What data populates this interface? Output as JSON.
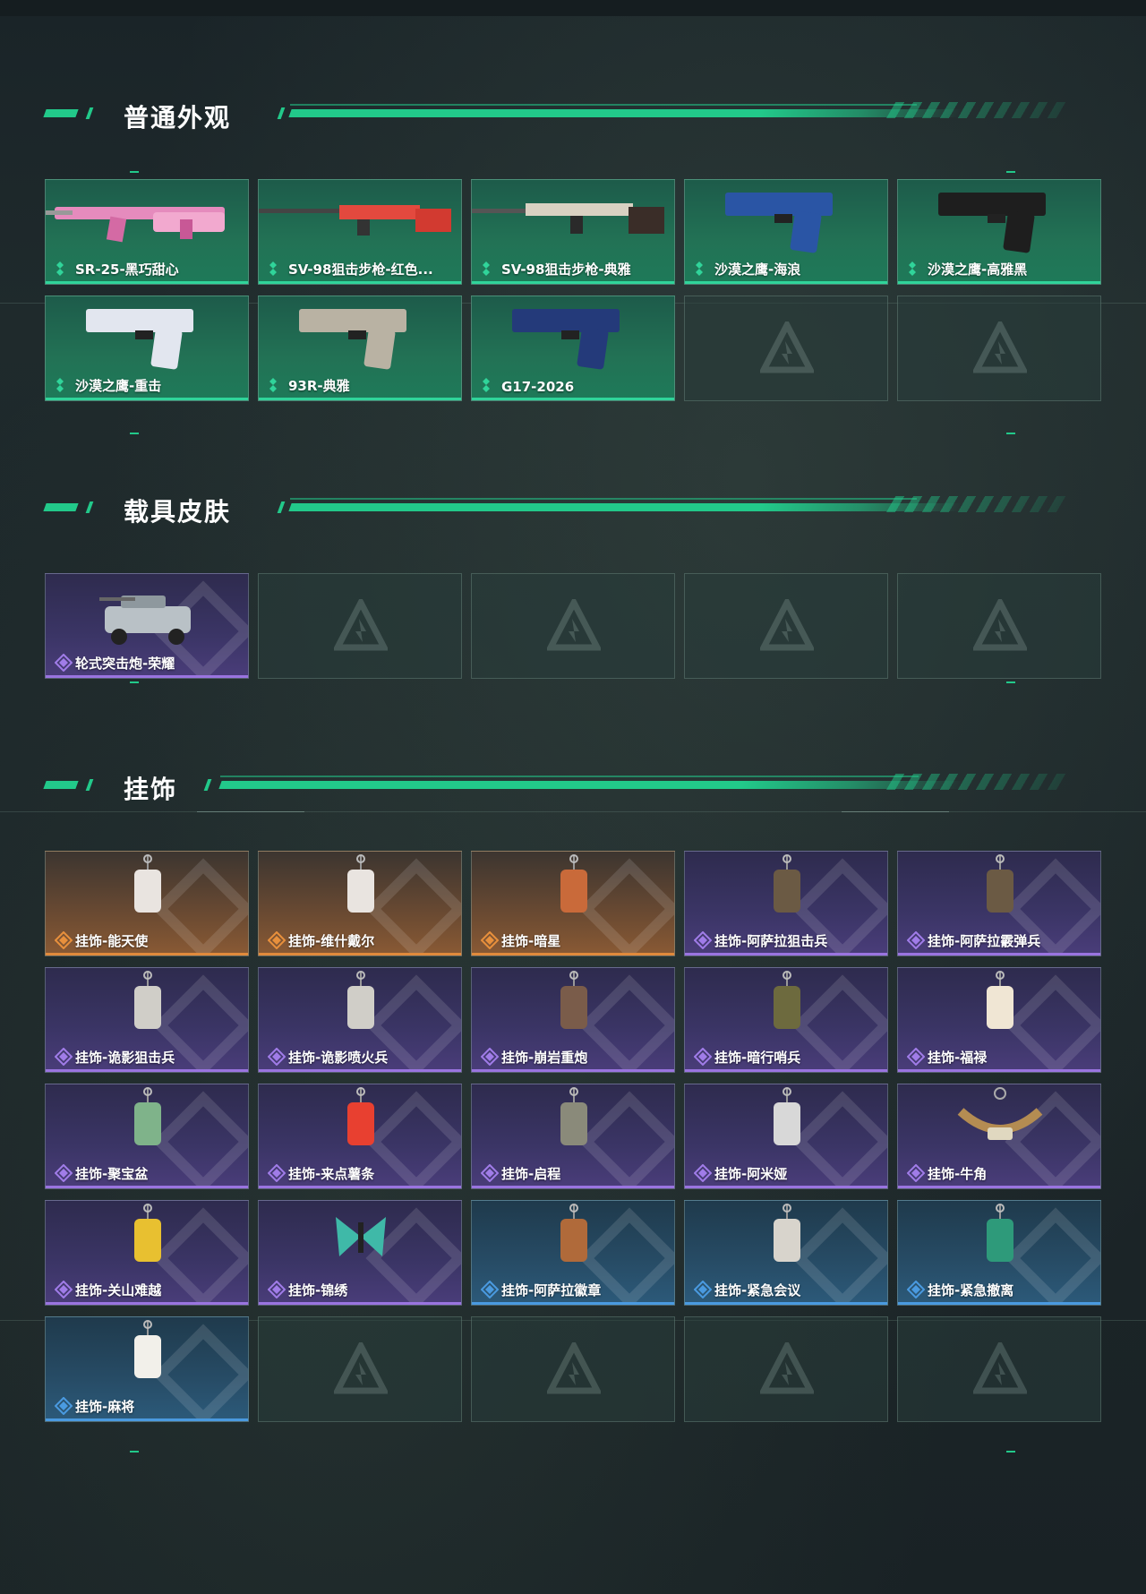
{
  "sections": {
    "weapon_skins": {
      "title": "普通外观",
      "items": [
        {
          "label": "SR-25-黑巧甜心",
          "rarity": "green",
          "icon": "rifle-pink-icon"
        },
        {
          "label": "SV-98狙击步枪-红色...",
          "rarity": "green",
          "icon": "sniper-red-icon"
        },
        {
          "label": "SV-98狙击步枪-典雅",
          "rarity": "green",
          "icon": "sniper-white-icon"
        },
        {
          "label": "沙漠之鹰-海浪",
          "rarity": "green",
          "icon": "pistol-blue-icon"
        },
        {
          "label": "沙漠之鹰-高雅黑",
          "rarity": "green",
          "icon": "pistol-black-icon"
        },
        {
          "label": "沙漠之鹰-重击",
          "rarity": "green",
          "icon": "pistol-white-blue-icon"
        },
        {
          "label": "93R-典雅",
          "rarity": "green",
          "icon": "pistol-tan-icon"
        },
        {
          "label": "G17-2026",
          "rarity": "green",
          "icon": "pistol-navy-icon"
        }
      ]
    },
    "vehicle_skins": {
      "title": "载具皮肤",
      "items": [
        {
          "label": "轮式突击炮-荣耀",
          "rarity": "purple",
          "icon": "armored-vehicle-icon"
        }
      ]
    },
    "charms": {
      "title": "挂饰",
      "items": [
        {
          "label": "挂饰-能天使",
          "rarity": "orange",
          "icon": "charm-tag-icon"
        },
        {
          "label": "挂饰-维什戴尔",
          "rarity": "orange",
          "icon": "charm-tag-icon"
        },
        {
          "label": "挂饰-暗星",
          "rarity": "orange",
          "icon": "charm-bird-icon"
        },
        {
          "label": "挂饰-阿萨拉狙击兵",
          "rarity": "purple",
          "icon": "charm-soldier-icon"
        },
        {
          "label": "挂饰-阿萨拉霰弹兵",
          "rarity": "purple",
          "icon": "charm-soldier-icon"
        },
        {
          "label": "挂饰-诡影狙击兵",
          "rarity": "purple",
          "icon": "charm-ghost-icon"
        },
        {
          "label": "挂饰-诡影喷火兵",
          "rarity": "purple",
          "icon": "charm-ghost-icon"
        },
        {
          "label": "挂饰-崩岩重炮",
          "rarity": "purple",
          "icon": "charm-rock-icon"
        },
        {
          "label": "挂饰-暗行哨兵",
          "rarity": "purple",
          "icon": "charm-sentry-icon"
        },
        {
          "label": "挂饰-福禄",
          "rarity": "purple",
          "icon": "charm-gourd-icon"
        },
        {
          "label": "挂饰-聚宝盆",
          "rarity": "purple",
          "icon": "charm-treasure-icon"
        },
        {
          "label": "挂饰-来点薯条",
          "rarity": "purple",
          "icon": "charm-fries-icon"
        },
        {
          "label": "挂饰-启程",
          "rarity": "purple",
          "icon": "charm-medal-icon"
        },
        {
          "label": "挂饰-阿米娅",
          "rarity": "purple",
          "icon": "charm-bunny-icon"
        },
        {
          "label": "挂饰-牛角",
          "rarity": "purple",
          "icon": "charm-horns-icon"
        },
        {
          "label": "挂饰-关山难越",
          "rarity": "purple",
          "icon": "charm-yellow-icon"
        },
        {
          "label": "挂饰-锦绣",
          "rarity": "purple",
          "icon": "charm-butterfly-icon"
        },
        {
          "label": "挂饰-阿萨拉徽章",
          "rarity": "blue",
          "icon": "charm-badge-icon"
        },
        {
          "label": "挂饰-紧急会议",
          "rarity": "blue",
          "icon": "charm-meeting-icon"
        },
        {
          "label": "挂饰-紧急撤离",
          "rarity": "blue",
          "icon": "charm-exit-icon"
        },
        {
          "label": "挂饰-麻将",
          "rarity": "blue",
          "icon": "charm-mahjong-icon"
        }
      ]
    }
  },
  "colors": {
    "accent": "#22c98a",
    "green": "#30d49a",
    "purple": "#9a74e0",
    "orange": "#e08a3c",
    "blue": "#4a9ae0"
  }
}
